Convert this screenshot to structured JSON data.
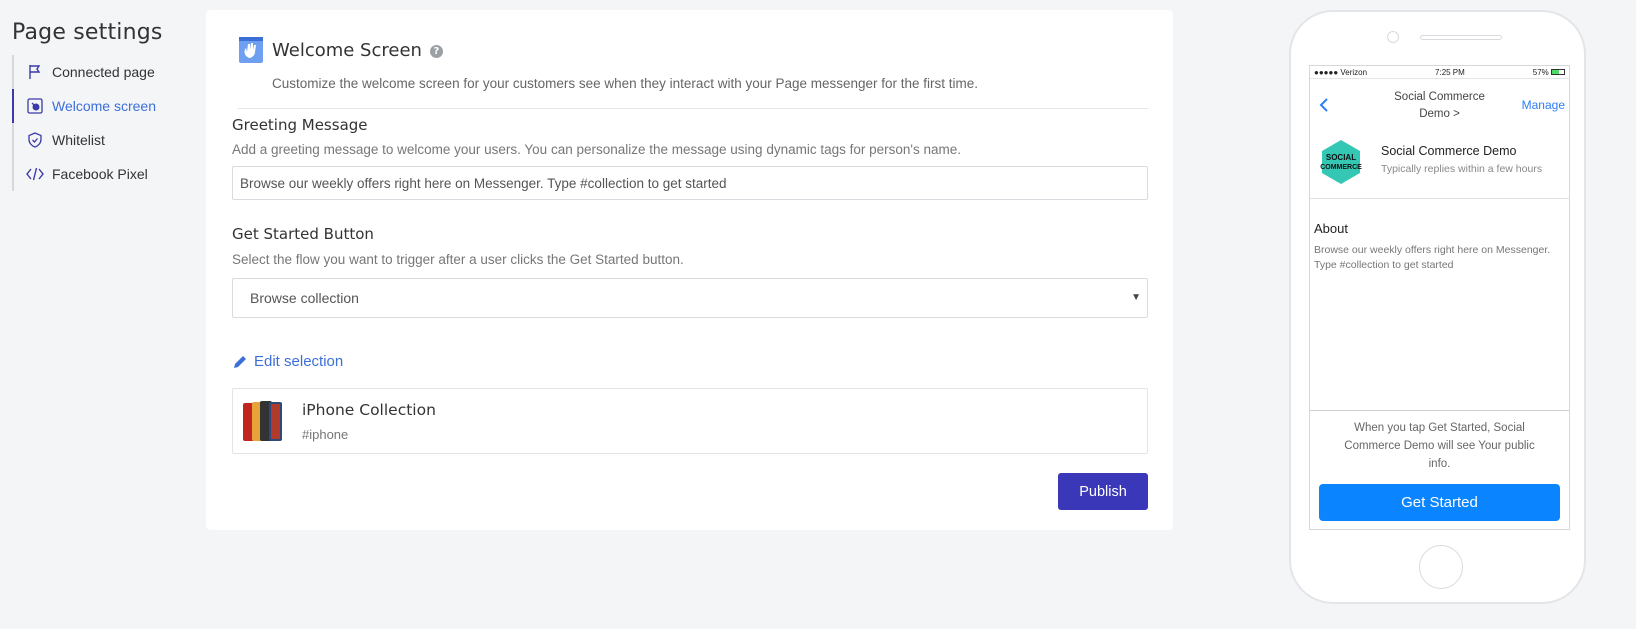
{
  "sidebar": {
    "title": "Page settings",
    "items": [
      {
        "label": "Connected page",
        "icon": "flag-icon",
        "active": false
      },
      {
        "label": "Welcome screen",
        "icon": "welcome-icon",
        "active": true
      },
      {
        "label": "Whitelist",
        "icon": "shield-icon",
        "active": false
      },
      {
        "label": "Facebook Pixel",
        "icon": "code-icon",
        "active": false
      }
    ]
  },
  "main": {
    "title": "Welcome Screen",
    "description": "Customize the welcome screen for your customers see when they interact with your Page messenger for the first time.",
    "greeting": {
      "label": "Greeting Message",
      "help": "Add a greeting message to welcome your users. You can personalize the message using dynamic tags for person's name.",
      "value": "Browse our weekly offers right here on Messenger. Type #collection to get started"
    },
    "get_started": {
      "label": "Get Started Button",
      "help": "Select the flow you want to trigger after a user clicks the Get Started button.",
      "selected": "Browse collection"
    },
    "edit_selection": "Edit selection",
    "collection": {
      "title": "iPhone Collection",
      "tag": "#iphone"
    },
    "publish_label": "Publish"
  },
  "preview": {
    "status": {
      "carrier": "●●●●● Verizon",
      "time": "7:25 PM",
      "battery": "57%"
    },
    "header_title_line1": "Social Commerce",
    "header_title_line2": "Demo >",
    "manage": "Manage",
    "page_name": "Social Commerce Demo",
    "reply_time": "Typically replies within a few hours",
    "logo_text_line1": "SOCIAL",
    "logo_text_line2": "COMMERCE",
    "about_title": "About",
    "about_text": "Browse our weekly offers right here on Messenger. Type #collection to get started",
    "consent": "When you tap Get Started, Social Commerce Demo will see Your public info.",
    "get_started_label": "Get Started"
  },
  "colors": {
    "accent": "#3c6fd8",
    "publish": "#3a37b8",
    "messenger_blue": "#0a84ff"
  }
}
